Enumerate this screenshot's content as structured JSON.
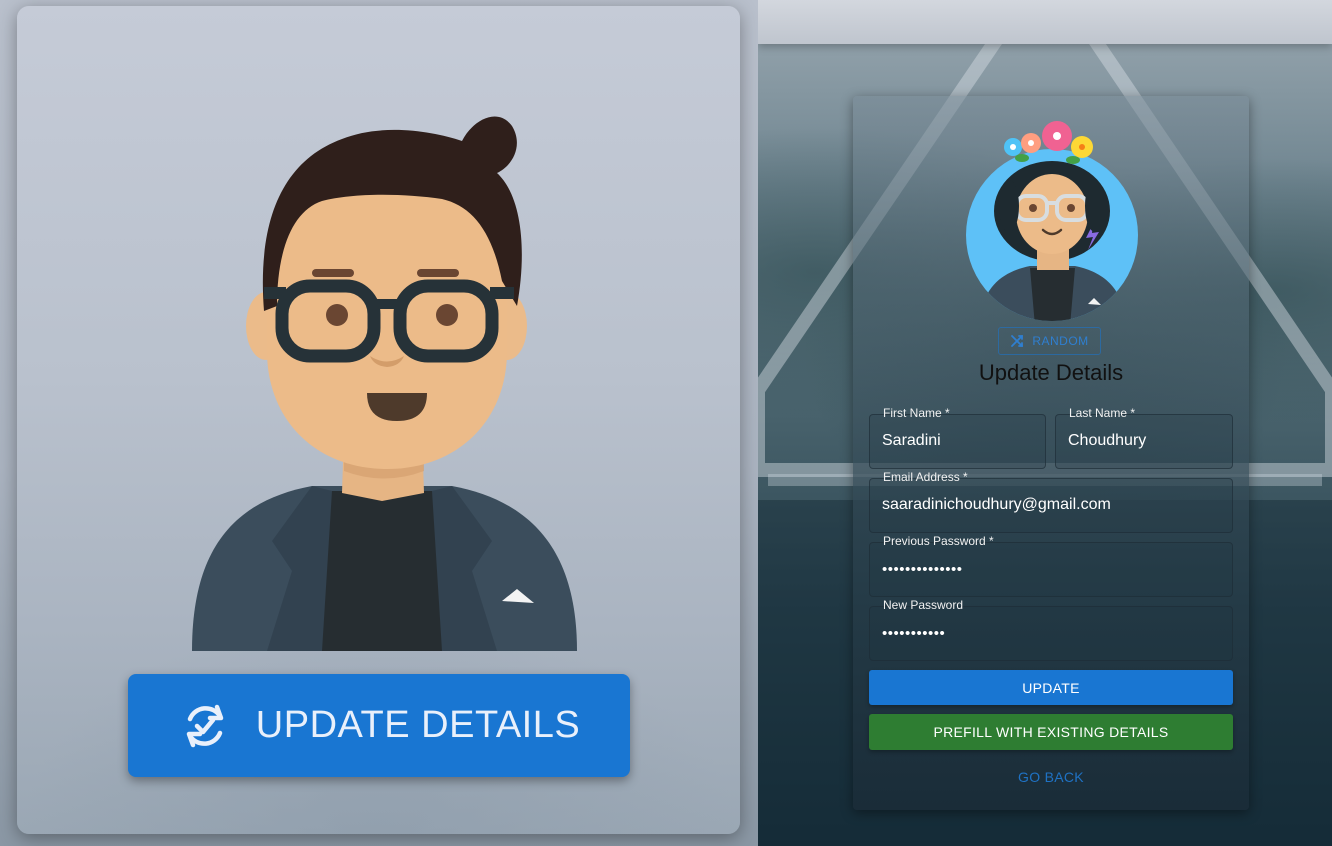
{
  "left_panel": {
    "update_button_label": "UPDATE DETAILS",
    "update_icon": "sync-check-icon",
    "avatar": "male-avatar-with-glasses"
  },
  "form": {
    "avatar": "female-avatar-with-flower-crown",
    "random_button_label": "RANDOM",
    "random_icon": "shuffle-icon",
    "title": "Update Details",
    "first_name": {
      "label": "First Name *",
      "value": "Saradini"
    },
    "last_name": {
      "label": "Last Name *",
      "value": "Choudhury"
    },
    "email": {
      "label": "Email Address *",
      "value": "saaradinichoudhury@gmail.com"
    },
    "previous_password": {
      "label": "Previous Password *",
      "value": "••••••••••••••"
    },
    "new_password": {
      "label": "New Password",
      "value": "•••••••••••"
    },
    "update_button_label": "UPDATE",
    "prefill_button_label": "PREFILL WITH EXISTING DETAILS",
    "go_back_label": "GO BACK"
  },
  "colors": {
    "primary": "#1976d2",
    "success": "#2e7d32",
    "link": "#1f72c4"
  }
}
